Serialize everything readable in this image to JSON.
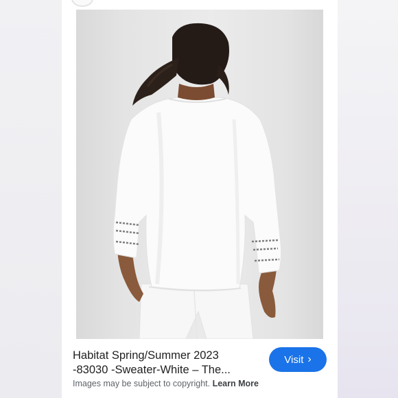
{
  "result": {
    "title_line1": "Habitat Spring/Summer 2023",
    "title_line2": "-83030 -Sweater-White – The...",
    "copyright_text": "Images may be subject to copyright.",
    "learn_more_label": "Learn More",
    "visit_label": "Visit",
    "visit_icon": "chevron-right-icon",
    "accent_color": "#1a73e8"
  },
  "image": {
    "subject": "woman-back-view-white-sweater-icon"
  }
}
